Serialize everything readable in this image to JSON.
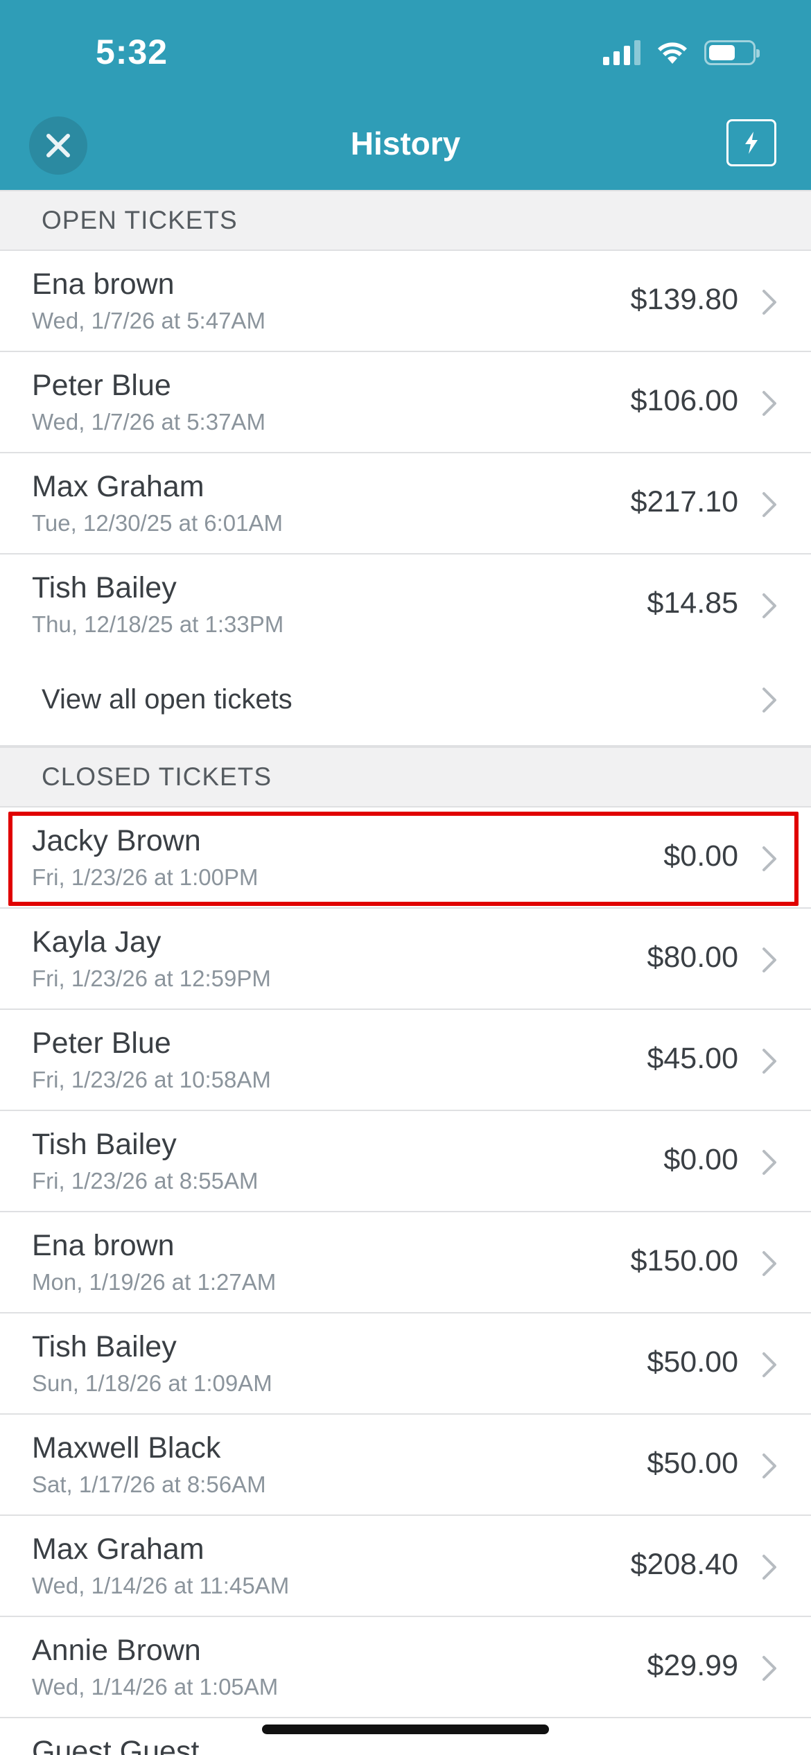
{
  "status_bar": {
    "time": "5:32"
  },
  "header": {
    "title": "History"
  },
  "sections": {
    "open": {
      "title": "OPEN TICKETS",
      "tickets": [
        {
          "name": "Ena brown",
          "date": "Wed, 1/7/26 at 5:47AM",
          "amount": "$139.80"
        },
        {
          "name": "Peter Blue",
          "date": "Wed, 1/7/26 at 5:37AM",
          "amount": "$106.00"
        },
        {
          "name": "Max Graham",
          "date": "Tue, 12/30/25 at 6:01AM",
          "amount": "$217.10"
        },
        {
          "name": "Tish Bailey",
          "date": "Thu, 12/18/25 at 1:33PM",
          "amount": "$14.85"
        }
      ],
      "view_all_label": "View all open tickets"
    },
    "closed": {
      "title": "CLOSED TICKETS",
      "tickets": [
        {
          "name": "Jacky Brown",
          "date": "Fri, 1/23/26 at 1:00PM",
          "amount": "$0.00"
        },
        {
          "name": "Kayla Jay",
          "date": "Fri, 1/23/26 at 12:59PM",
          "amount": "$80.00"
        },
        {
          "name": "Peter Blue",
          "date": "Fri, 1/23/26 at 10:58AM",
          "amount": "$45.00"
        },
        {
          "name": "Tish Bailey",
          "date": "Fri, 1/23/26 at 8:55AM",
          "amount": "$0.00"
        },
        {
          "name": "Ena brown",
          "date": "Mon, 1/19/26 at 1:27AM",
          "amount": "$150.00"
        },
        {
          "name": "Tish Bailey",
          "date": "Sun, 1/18/26 at 1:09AM",
          "amount": "$50.00"
        },
        {
          "name": "Maxwell Black",
          "date": "Sat, 1/17/26 at 8:56AM",
          "amount": "$50.00"
        },
        {
          "name": "Max Graham",
          "date": "Wed, 1/14/26 at 11:45AM",
          "amount": "$208.40"
        },
        {
          "name": "Annie Brown",
          "date": "Wed, 1/14/26 at 1:05AM",
          "amount": "$29.99"
        },
        {
          "name": "Guest Guest",
          "date": "",
          "amount": ""
        }
      ]
    }
  },
  "colors": {
    "header_bg": "#2f9db7",
    "highlight": "#e00000"
  }
}
